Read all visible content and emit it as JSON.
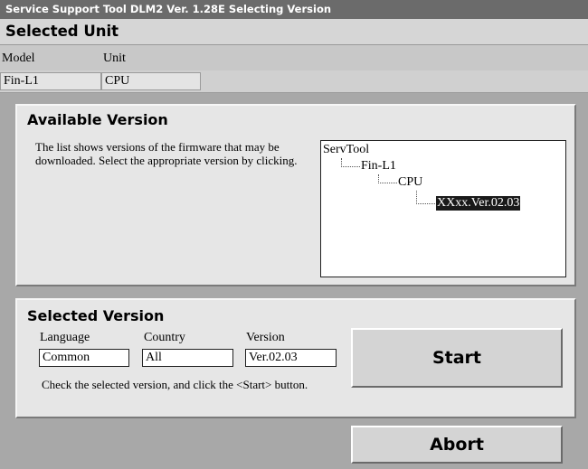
{
  "window": {
    "title": "Service Support Tool DLM2 Ver. 1.28E  Selecting Version"
  },
  "selected_unit": {
    "heading": "Selected Unit",
    "columns": [
      "Model",
      "Unit"
    ],
    "values": [
      "Fin-L1",
      "CPU"
    ]
  },
  "available_version": {
    "heading": "Available Version",
    "description": "The list shows versions of the firmware that may be downloaded. Select the appropriate version by clicking.",
    "tree": {
      "root": "ServTool",
      "model": "Fin-L1",
      "unit": "CPU",
      "version": "XXxx.Ver.02.03"
    }
  },
  "selected_version": {
    "heading": "Selected Version",
    "language_label": "Language",
    "language_value": "Common",
    "country_label": "Country",
    "country_value": "All",
    "version_label": "Version",
    "version_value": "Ver.02.03",
    "instruction": "Check the selected version, and click the <Start> button."
  },
  "buttons": {
    "start": "Start",
    "abort": "Abort"
  }
}
